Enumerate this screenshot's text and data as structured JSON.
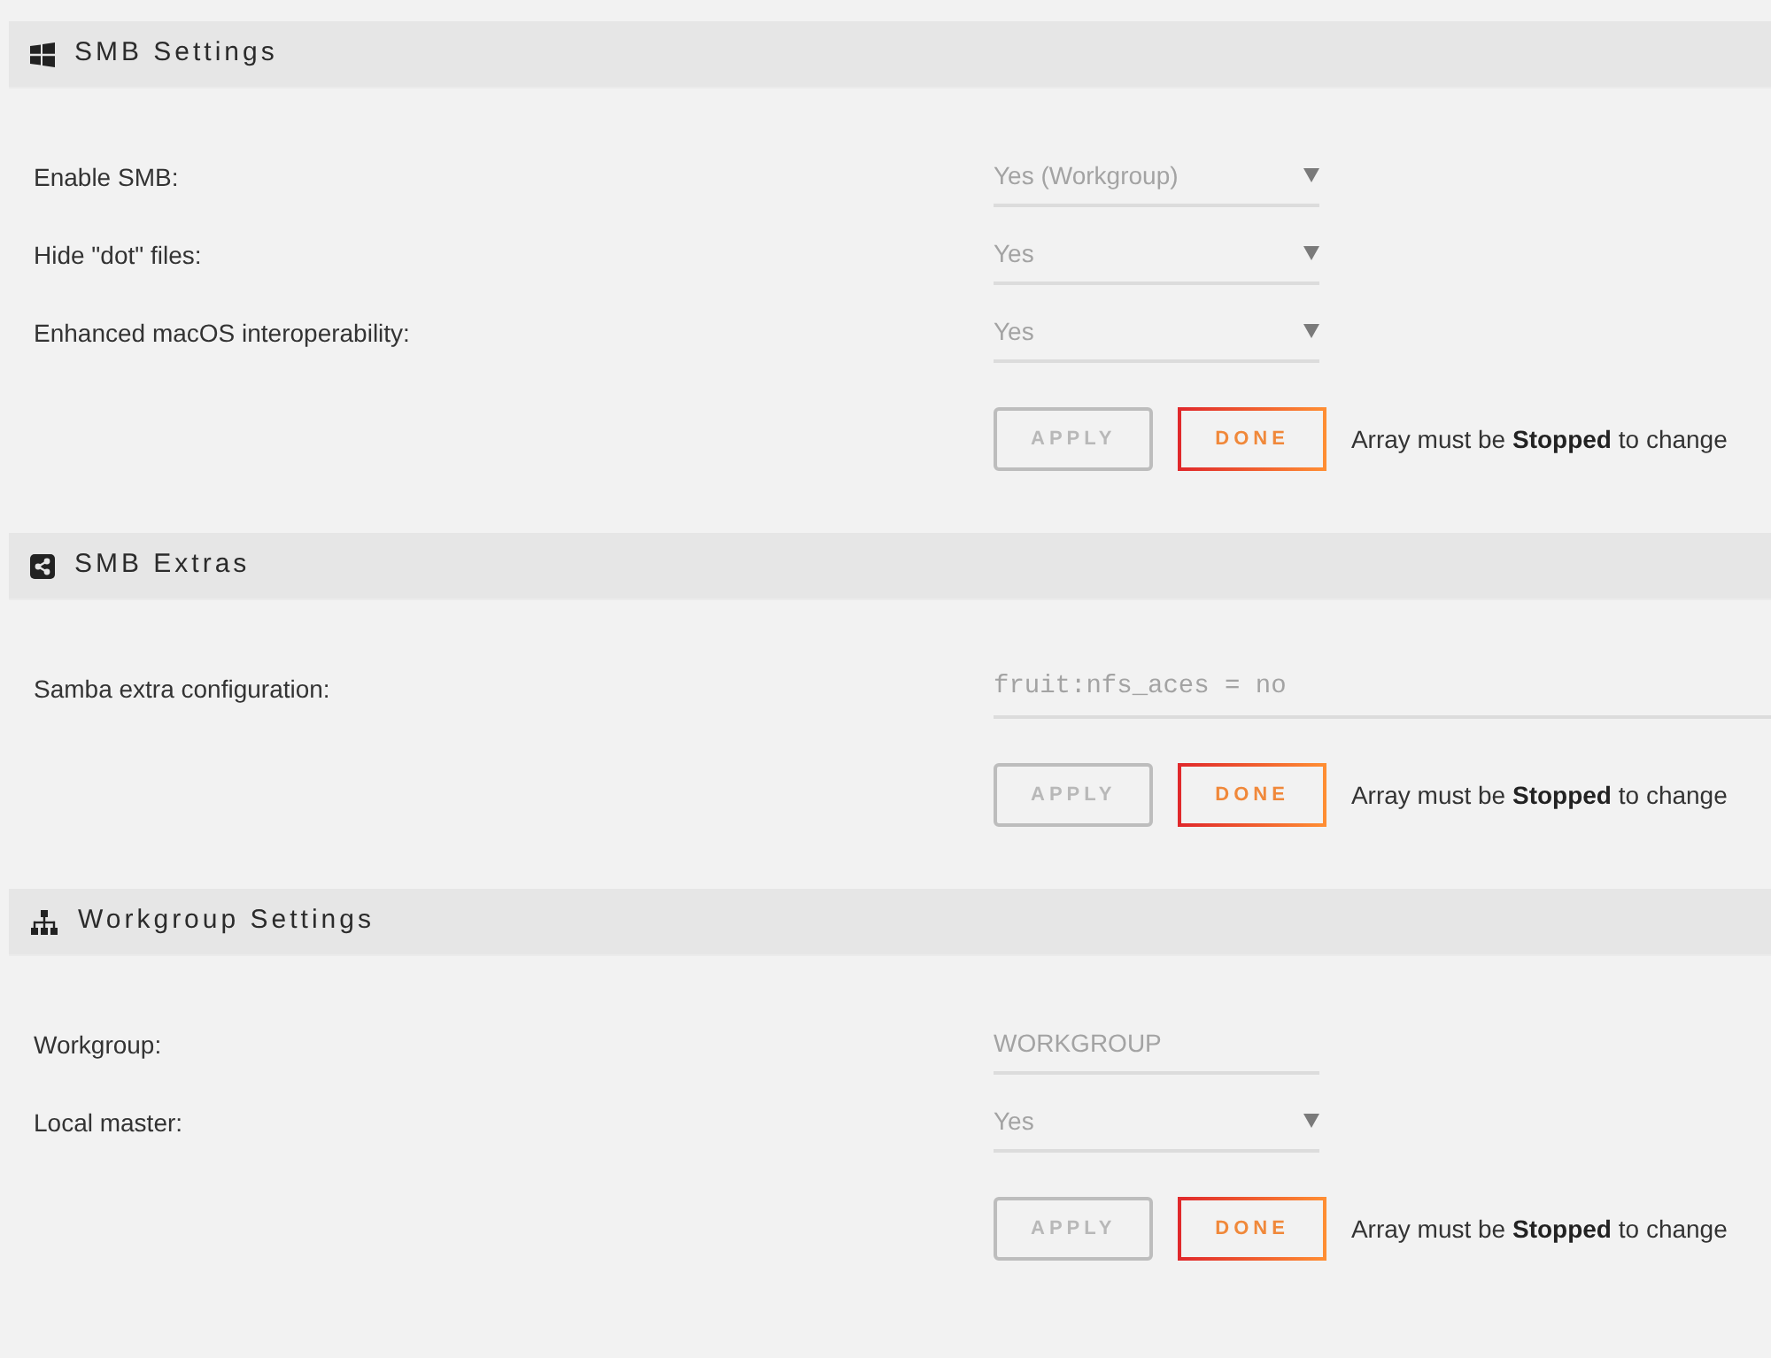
{
  "sections": [
    {
      "title": "SMB Settings",
      "fields": [
        {
          "label": "Enable SMB:",
          "kind": "select",
          "value": "Yes (Workgroup)",
          "disabled": true
        },
        {
          "label": "Hide \"dot\" files:",
          "kind": "select",
          "value": "Yes",
          "disabled": true
        },
        {
          "label": "Enhanced macOS interoperability:",
          "kind": "select",
          "value": "Yes",
          "disabled": true
        }
      ],
      "buttons": [
        {
          "label": "APPLY",
          "disabled": true
        },
        {
          "label": "DONE",
          "disabled": false
        }
      ],
      "message": "Array must be **Stopped** to change"
    },
    {
      "title": "SMB Extras",
      "fields": [
        {
          "label": "Samba extra configuration:",
          "kind": "code",
          "value": "fruit:nfs_aces = no",
          "disabled": true
        }
      ],
      "buttons": [
        {
          "label": "APPLY",
          "disabled": true
        },
        {
          "label": "DONE",
          "disabled": false
        }
      ],
      "message": "Array must be **Stopped** to change"
    },
    {
      "title": "Workgroup Settings",
      "fields": [
        {
          "label": "Workgroup:",
          "kind": "text",
          "value": "WORKGROUP",
          "disabled": true
        },
        {
          "label": "Local master:",
          "kind": "select",
          "value": "Yes",
          "disabled": true
        }
      ],
      "buttons": [
        {
          "label": "APPLY",
          "disabled": true
        },
        {
          "label": "DONE",
          "disabled": false
        }
      ],
      "message": "Array must be **Stopped** to change"
    }
  ]
}
